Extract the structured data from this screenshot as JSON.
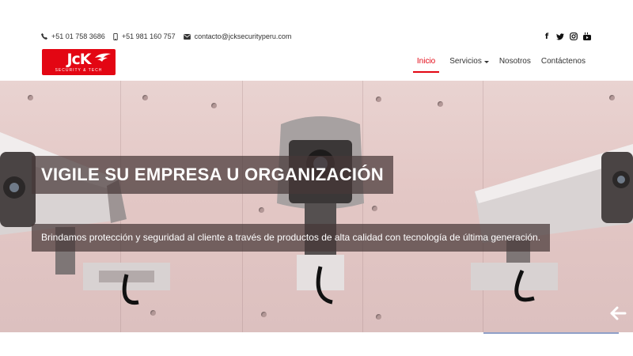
{
  "contact": {
    "phone1": "+51 01 758 3686",
    "phone2": "+51 981 160 757",
    "email": "contacto@jcksecurityperu.com"
  },
  "social": [
    {
      "name": "facebook-icon",
      "glyph": "f"
    },
    {
      "name": "twitter-icon",
      "glyph": "🐦"
    },
    {
      "name": "instagram-icon",
      "glyph": "◎"
    },
    {
      "name": "youtube-icon",
      "glyph": "▶"
    }
  ],
  "logo": {
    "mark": "JcK",
    "sub": "SECURITY & TECH"
  },
  "nav": {
    "inicio": "Inicio",
    "servicios": "Servicios",
    "nosotros": "Nosotros",
    "contactenos": "Contáctenos"
  },
  "hero": {
    "headline": "VIGILE SU EMPRESA U ORGANIZACIÓN",
    "subline": "Brindamos protección y seguridad al cliente a través de productos de alta calidad con tecnología de última generación."
  },
  "colors": {
    "brand": "#e30613",
    "overlay": "#463737"
  }
}
